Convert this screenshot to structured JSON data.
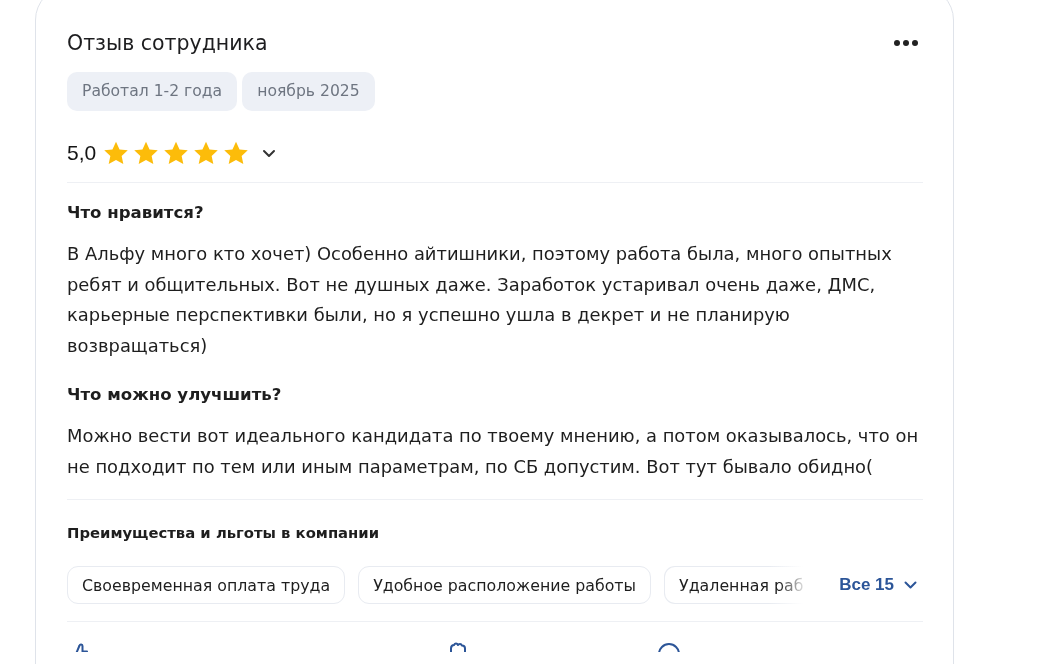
{
  "review": {
    "title": "Отзыв сотрудника",
    "tags": [
      "Работал 1-2 года",
      "ноябрь 2025"
    ],
    "rating": {
      "value": "5,0",
      "stars": 5
    },
    "sections": [
      {
        "heading": "Что нравится?",
        "text": "В Альфу много кто хочет) Особенно айтишники, поэтому работа была, много опытных ребят и общительных. Вот не душных даже. Заработок устаривал очень даже, ДМС, карьерные перспективки были, но я успешно ушла в декрет и не планирую возвращаться)"
      },
      {
        "heading": "Что можно улучшить?",
        "text": "Можно вести вот идеального кандидата по твоему мнению, а потом оказывалось, что он не подходит по тем или иным параметрам, по СБ допустим. Вот тут бывало обидно("
      }
    ],
    "benefits": {
      "heading": "Преимущества и льготы в компании",
      "items": [
        "Своевременная оплата труда",
        "Удобное расположение работы",
        "Удаленная раб"
      ],
      "more": "Все 15"
    }
  }
}
